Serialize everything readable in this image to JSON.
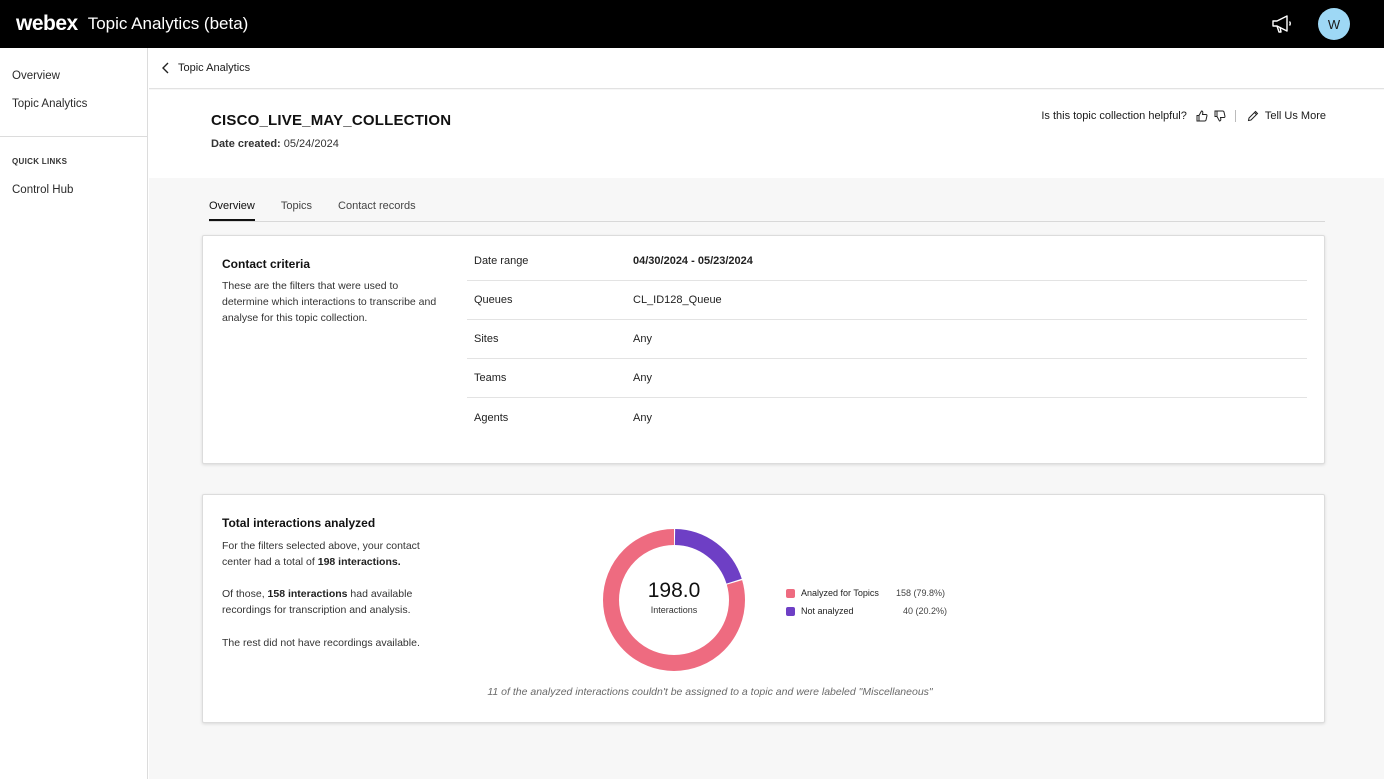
{
  "topbar": {
    "brand": "webex",
    "app_title": "Topic Analytics (beta)",
    "avatar_initial": "W"
  },
  "sidebar": {
    "items": [
      {
        "label": "Overview"
      },
      {
        "label": "Topic Analytics"
      }
    ],
    "quick_links_heading": "QUICK LINKS",
    "quick_links": [
      {
        "label": "Control Hub"
      }
    ]
  },
  "breadcrumb": {
    "label": "Topic Analytics"
  },
  "header": {
    "title": "CISCO_LIVE_MAY_COLLECTION",
    "date_created_label": "Date created:",
    "date_created_value": "05/24/2024",
    "feedback_question": "Is this topic collection helpful?",
    "tell_us_more": "Tell Us More"
  },
  "tabs": [
    {
      "label": "Overview",
      "active": true
    },
    {
      "label": "Topics",
      "active": false
    },
    {
      "label": "Contact records",
      "active": false
    }
  ],
  "contact_criteria": {
    "title": "Contact criteria",
    "description": "These are the filters that were used to determine which interactions to transcribe and analyse for this topic collection.",
    "rows": [
      {
        "key": "Date range",
        "value": "04/30/2024 - 05/23/2024"
      },
      {
        "key": "Queues",
        "value": "CL_ID128_Queue"
      },
      {
        "key": "Sites",
        "value": "Any"
      },
      {
        "key": "Teams",
        "value": "Any"
      },
      {
        "key": "Agents",
        "value": "Any"
      }
    ]
  },
  "interactions": {
    "title": "Total interactions analyzed",
    "p1_text": "For the filters selected above, your contact center had a total of",
    "p1_bold": "198 interactions.",
    "p2_prefix": "Of those,",
    "p2_bold": "158 interactions",
    "p2_suffix": "had available recordings for transcription and analysis.",
    "p3_text": "The rest did not have recordings available.",
    "center_value": "198.0",
    "center_label": "Interactions",
    "note": "11 of the analyzed interactions couldn't be assigned to a topic and were labeled \"Miscellaneous\""
  },
  "chart_data": {
    "type": "pie",
    "donut": true,
    "total": 198,
    "series": [
      {
        "name": "Analyzed for Topics",
        "value": 158,
        "display": "158 (79.8%)",
        "color": "#ee6b80"
      },
      {
        "name": "Not analyzed",
        "value": 40,
        "display": "40 (20.2%)",
        "color": "#6e3fc5"
      }
    ]
  },
  "colors": {
    "topbar_bg": "#000000",
    "avatar_bg": "#9ed8f5",
    "analyzed": "#ee6b80",
    "not_analyzed": "#6e3fc5"
  },
  "icons": {
    "megaphone": "megaphone-icon",
    "back": "chevron-left-icon",
    "thumbs_up": "thumbs-up-icon",
    "thumbs_down": "thumbs-down-icon",
    "edit": "pencil-icon"
  }
}
